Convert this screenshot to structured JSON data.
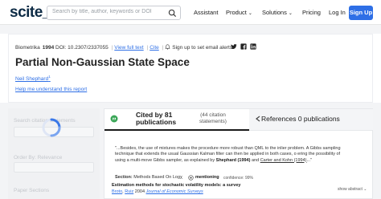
{
  "nav": {
    "logo": "scite_",
    "search_placeholder": "Search by title, author, keywords or DOI",
    "links": [
      "Assistant",
      "Product",
      "Solutions",
      "Pricing",
      "Log In"
    ],
    "signup": "Sign Up",
    "accent": "#2e6fe6"
  },
  "article": {
    "journal": "Biometrika",
    "year": "1994",
    "doi": "DOI: 10.2307/2337055",
    "view_full_text": "View full text",
    "cite": "Cite",
    "signup_alerts": "Sign up to set email alerts",
    "title": "Partial Non-Gaussian State Space",
    "author": "Neil Shephard",
    "author_sup": "1",
    "help": "Help me understand this report"
  },
  "sidebar": {
    "search_citation": "Search citation statements",
    "order_by": "Order By: Relevance",
    "paper_sections": "Paper Sections"
  },
  "tabs": {
    "cited_title": "Cited by 81 publications",
    "cited_sub": "(44 citation statements)",
    "references": "References 0 publications"
  },
  "citation": {
    "quote_pre": "\"...Besides, the use of mixtures makes the procedure more robust than QML to the inlier problem. A Gibbs sampling technique that extends the usual Gaussian Kalman filter can then be applied in both cases, o ering the possibility of using a multi-move Gibbs sampler, as explained by ",
    "quote_hl": "Shephard (1994)",
    "quote_mid": " and ",
    "quote_ul": "Carter and Kohn (1994)",
    "quote_end": "...\"",
    "section_label": "Section:",
    "section_value": "Methods Based On Logχ",
    "mentioning": "mentioning",
    "confidence": "confidence: 99%",
    "paper_title": "Estimation methods for stochastic volatility models: a survey",
    "author1": "Broto",
    "author2": "Ruiz",
    "year_journal_pre": " 2004 ",
    "journal": "Journal of Economic Surveys",
    "show_abstract": "show abstract"
  }
}
